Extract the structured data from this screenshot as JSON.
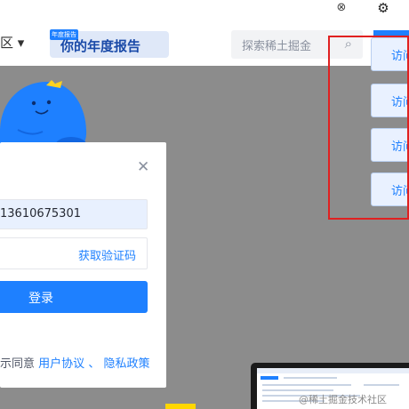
{
  "header": {
    "region_label": "区 ▾",
    "banner_tag": "年度报告",
    "banner_text": "你的年度报告",
    "search_placeholder": "探索稀土掘金"
  },
  "visit_buttons": [
    "访问",
    "访问",
    "访问",
    "访问"
  ],
  "login_modal": {
    "phone_value": "13610675301",
    "get_code_link": "获取验证码",
    "login_button": "登录",
    "agree_prefix": "示同意",
    "user_agreement": "用户协议",
    "separator": "、",
    "privacy_policy": "隐私政策"
  },
  "watermark": "@稀土掘金技术社区",
  "colors": {
    "accent": "#1e80ff",
    "overlay": "#8c8c8c",
    "highlight_box": "#e02020",
    "mascot": "#1e80ff"
  }
}
